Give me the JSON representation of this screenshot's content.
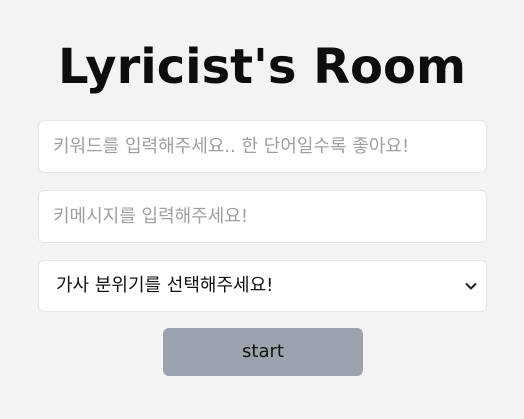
{
  "title": "Lyricist's Room",
  "keyword_input": {
    "value": "",
    "placeholder": "키워드를 입력해주세요.. 한 단어일수록 좋아요!"
  },
  "key_message_input": {
    "value": "",
    "placeholder": "키메시지를 입력해주세요!"
  },
  "mood_select": {
    "selected": "가사 분위기를 선택해주세요!",
    "icon": "chevron-down-icon"
  },
  "start_button": {
    "label": "start"
  },
  "colors": {
    "background": "#f2f3f5",
    "button": "#9ca3af",
    "field_border": "#e3e5e8",
    "placeholder": "#9ca0a6"
  }
}
